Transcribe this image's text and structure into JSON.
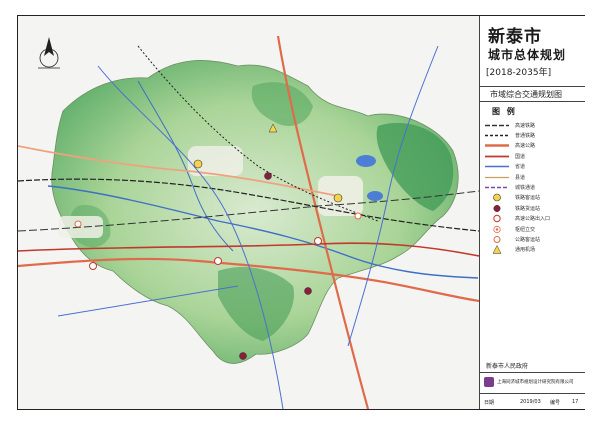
{
  "header": {
    "city": "新泰市",
    "plan": "城市总体规划",
    "years": "[2018-2035年]"
  },
  "sheet_title": "市域综合交通规划图",
  "legend": {
    "heading": "图 例",
    "items": [
      {
        "label": "高速铁路",
        "icon": "dashed-railway-swatch"
      },
      {
        "label": "普通铁路",
        "icon": "railway-swatch"
      },
      {
        "label": "高速公路",
        "icon": "expressway-swatch"
      },
      {
        "label": "国道",
        "icon": "national-road-swatch"
      },
      {
        "label": "省道",
        "icon": "provincial-road-swatch"
      },
      {
        "label": "县道",
        "icon": "county-road-swatch"
      },
      {
        "label": "城铁通道",
        "icon": "intercity-rail-swatch"
      },
      {
        "label": "铁路客运站",
        "icon": "passenger-station-icon"
      },
      {
        "label": "铁路货运站",
        "icon": "freight-station-icon"
      },
      {
        "label": "高速公路出入口",
        "icon": "expressway-exit-icon"
      },
      {
        "label": "枢纽立交",
        "icon": "interchange-icon"
      },
      {
        "label": "公路客运站",
        "icon": "bus-station-icon"
      },
      {
        "label": "通用机场",
        "icon": "airport-icon"
      }
    ]
  },
  "footer": {
    "government": "新泰市人民政府",
    "institute": "上海同济城市规划设计研究院有限公司",
    "date_label": "日期",
    "date_value": "2019/03",
    "number_label": "编号",
    "number_value": "17"
  },
  "colors": {
    "terrain_light": "#cfe4b8",
    "terrain_mid": "#9fcf8a",
    "terrain_dark": "#3f9a55",
    "river": "#3d6fc4",
    "lake": "#4c7ed6",
    "expressway": "#e06b4a",
    "national_road": "#c0392b",
    "railway": "#222222",
    "urban": "#eef0e6"
  }
}
